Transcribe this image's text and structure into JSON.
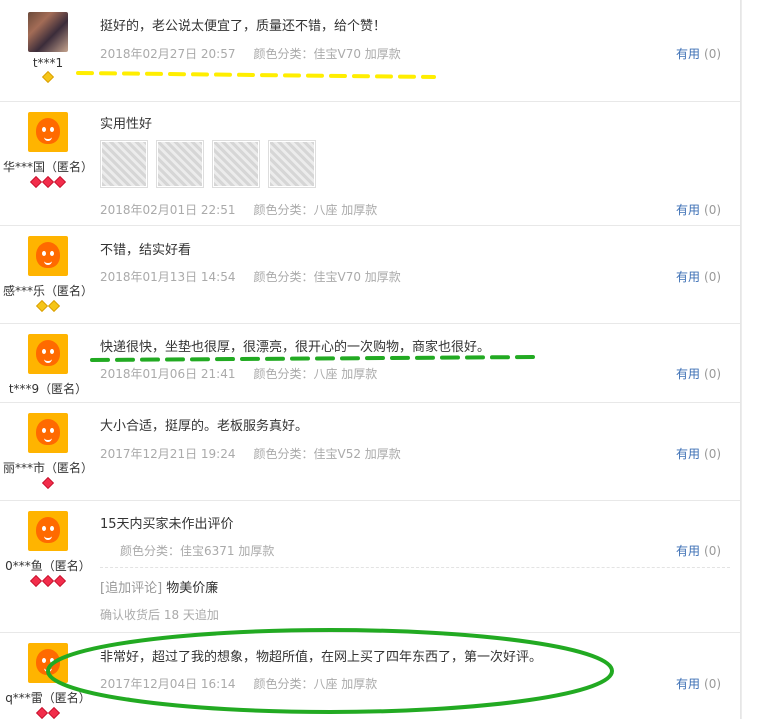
{
  "useful_label": "有用",
  "reviews": [
    {
      "user": "t***1",
      "avatar": "photo-icon",
      "level": "gold",
      "gems": 1,
      "content": "挺好的，老公说太便宜了，质量还不错，给个赞！",
      "date": "2018年02月27日 20:57",
      "sku": "颜色分类：佳宝V70 加厚款",
      "count": "(0)"
    },
    {
      "user": "华***国（匿名）",
      "avatar": "default-avatar-icon",
      "level": "red",
      "gems": 3,
      "content": "实用性好",
      "date": "2018年02月01日 22:51",
      "sku": "颜色分类：八座 加厚款",
      "count": "(0)"
    },
    {
      "user": "感***乐（匿名）",
      "avatar": "default-avatar-icon",
      "level": "gold",
      "gems": 2,
      "content": "不错，结实好看",
      "date": "2018年01月13日 14:54",
      "sku": "颜色分类：佳宝V70 加厚款",
      "count": "(0)"
    },
    {
      "user": "t***9（匿名）",
      "avatar": "default-avatar-icon",
      "level": "none",
      "gems": 0,
      "content": "快递很快，坐垫也很厚，很漂亮，很开心的一次购物，商家也很好。",
      "date": "2018年01月06日 21:41",
      "sku": "颜色分类：八座 加厚款",
      "count": "(0)"
    },
    {
      "user": "丽***市（匿名）",
      "avatar": "default-avatar-icon",
      "level": "red",
      "gems": 1,
      "content": "大小合适，挺厚的。老板服务真好。",
      "date": "2017年12月21日 19:24",
      "sku": "颜色分类：佳宝V52 加厚款",
      "count": "(0)"
    },
    {
      "user": "0***鱼（匿名）",
      "avatar": "default-avatar-icon",
      "level": "red",
      "gems": 3,
      "content": "15天内买家未作出评价",
      "date": "",
      "sku": "颜色分类：佳宝6371 加厚款",
      "count": "(0)",
      "followup_label": "[追加评论]",
      "followup_text": "物美价廉",
      "followup_meta": "确认收货后 18 天追加"
    },
    {
      "user": "q***雷（匿名）",
      "avatar": "default-avatar-icon",
      "level": "red",
      "gems": 2,
      "content": "非常好，超过了我的想象，物超所值，在网上买了四年东西了，第一次好评。",
      "date": "2017年12月04日 16:14",
      "sku": "颜色分类：八座 加厚款",
      "count": "(0)"
    }
  ],
  "colors": {
    "useful": "#3c6fb5",
    "meta": "#aaaaaa",
    "annot_yellow": "#ffee00",
    "annot_green": "#22aa22"
  }
}
